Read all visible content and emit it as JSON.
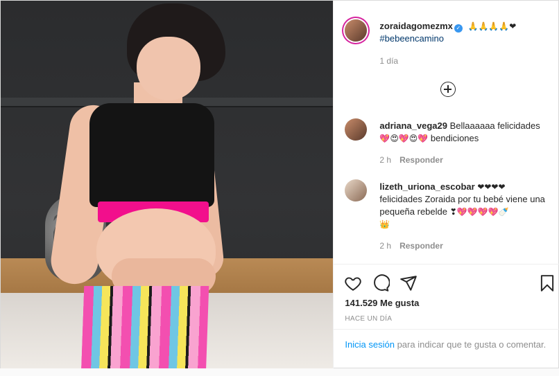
{
  "post": {
    "author": "zoraidagomezmx",
    "verified_glyph": "✓",
    "caption_emojis": "🙏🙏🙏🙏❤",
    "hashtag": "#bebeencamino",
    "caption_time": "1 día",
    "load_more_icon": "plus-circle-icon"
  },
  "comments": [
    {
      "user": "adriana_vega29",
      "text": "Bellaaaaaa felicidades",
      "emojis": "💖😍💖😍💖",
      "text2": "bendiciones",
      "time": "2 h",
      "reply": "Responder"
    },
    {
      "user": "lizeth_uriona_escobar",
      "emojis": "❤❤❤❤",
      "text": "felicidades Zoraida por tu bebé viene una pequeña rebelde",
      "emojis2": "❣💖💖💖💖🍼",
      "emojis3": "👑",
      "time": "2 h",
      "reply": "Responder"
    }
  ],
  "actions": {
    "like_icon": "heart-icon",
    "comment_icon": "comment-icon",
    "share_icon": "share-icon",
    "save_icon": "bookmark-icon",
    "likes_count": "141.529",
    "likes_label": "Me gusta",
    "timestamp": "HACE UN DÍA"
  },
  "login_prompt": {
    "link": "Inicia sesión",
    "text": "para indicar que te gusta o comentar."
  },
  "colors": {
    "link": "#00376b",
    "accent": "#0095f6",
    "muted": "#8e8e8e",
    "verified": "#3897f0"
  }
}
